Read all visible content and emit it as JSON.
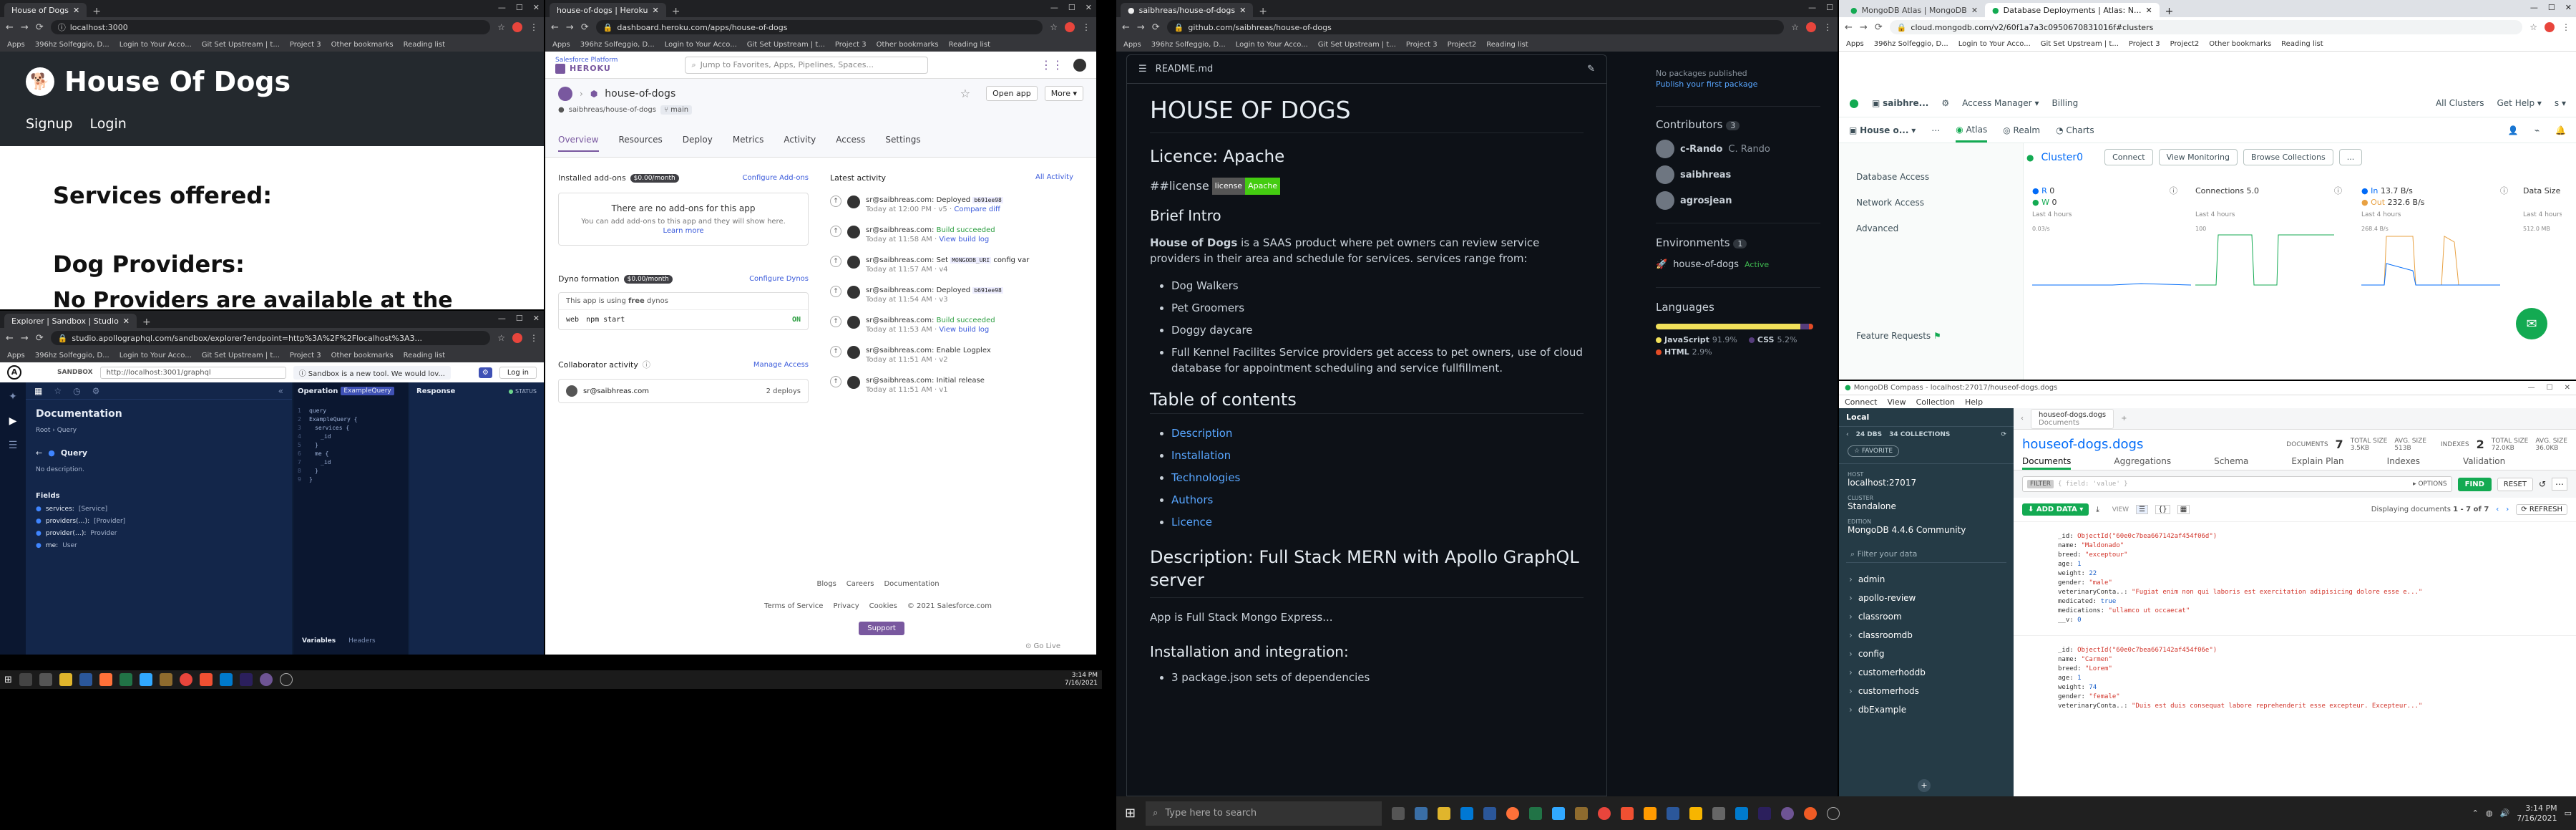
{
  "w1": {
    "tab": "House of Dogs",
    "url": "localhost:3000",
    "bookmarks": [
      "Apps",
      "396hz Solfeggio, D...",
      "Login to Your Acco...",
      "Git Set Upstream | t...",
      "Project 3",
      "Other bookmarks",
      "Reading list"
    ],
    "brand": "House Of Dogs",
    "nav": [
      "Signup",
      "Login"
    ],
    "services": "Services offered:",
    "providers": "Dog Providers:",
    "none": "No Providers are available at the moment!"
  },
  "w2": {
    "tab": "house-of-dogs | Heroku",
    "url": "dashboard.heroku.com/apps/house-of-dogs",
    "platform": "Salesforce Platform",
    "brand": "HEROKU",
    "search": "Jump to Favorites, Apps, Pipelines, Spaces...",
    "app": "house-of-dogs",
    "repo": "saibhreas/house-of-dogs",
    "branch": "main",
    "open": "Open app",
    "more": "More",
    "tabs": [
      "Overview",
      "Resources",
      "Deploy",
      "Metrics",
      "Activity",
      "Access",
      "Settings"
    ],
    "addons_title": "Installed add-ons",
    "addons_cost": "$0.00/month",
    "configure_addons": "Configure Add-ons",
    "no_addons": "There are no add-ons for this app",
    "no_addons_sub": "You can add add-ons to this app and they will show here.",
    "learn": "Learn more",
    "dyno_title": "Dyno formation",
    "dyno_cost": "$0.00/month",
    "configure_dynos": "Configure Dynos",
    "dyno_note": "This app is using",
    "dyno_free": "free",
    "dyno_note2": "dynos",
    "web": "web",
    "cmd": "npm start",
    "on": "ON",
    "collab_title": "Collaborator activity",
    "manage": "Manage Access",
    "collab_email": "sr@saibhreas.com",
    "collab_deploys": "2 deploys",
    "latest": "Latest activity",
    "all_activity": "All Activity",
    "activity": [
      {
        "who": "sr@saibhreas.com:",
        "what": "Deployed",
        "hash": "b691ee98",
        "when": "Today at 12:00 PM · v5",
        "link": "Compare diff"
      },
      {
        "who": "sr@saibhreas.com:",
        "what": "Build succeeded",
        "hash": "",
        "when": "Today at 11:58 AM",
        "link": "View build log"
      },
      {
        "who": "sr@saibhreas.com:",
        "what": "Set",
        "hash": "MONGODB_URI",
        "extra": "config var",
        "when": "Today at 11:57 AM · v4",
        "link": ""
      },
      {
        "who": "sr@saibhreas.com:",
        "what": "Deployed",
        "hash": "b691ee98",
        "when": "Today at 11:54 AM · v3",
        "link": ""
      },
      {
        "who": "sr@saibhreas.com:",
        "what": "Build succeeded",
        "hash": "",
        "when": "Today at 11:53 AM",
        "link": "View build log"
      },
      {
        "who": "sr@saibhreas.com:",
        "what": "Enable Logplex",
        "hash": "",
        "when": "Today at 11:51 AM · v2",
        "link": ""
      },
      {
        "who": "sr@saibhreas.com:",
        "what": "Initial release",
        "hash": "",
        "when": "Today at 11:51 AM · v1",
        "link": ""
      }
    ],
    "footer1": [
      "Blogs",
      "Careers",
      "Documentation"
    ],
    "footer2": [
      "Terms of Service",
      "Privacy",
      "Cookies",
      "© 2021 Salesforce.com"
    ],
    "support": "Support",
    "golive": "Go Live"
  },
  "w3": {
    "tab": "Explorer | Sandbox | Studio",
    "url": "studio.apollographql.com/sandbox/explorer?endpoint=http%3A%2F%2Flocalhost%3A3...",
    "sandbox": "SANDBOX",
    "endpoint": "http://localhost:3001/graphql",
    "notice": "Sandbox is a new tool. We would lov...",
    "login": "Log in",
    "doc_title": "Documentation",
    "root": "Root",
    "query_crumb": "Query",
    "query_label": "Query",
    "no_desc": "No description.",
    "fields": "Fields",
    "field_list": [
      {
        "name": "services:",
        "type": "[Service]"
      },
      {
        "name": "providers(…):",
        "type": "[Provider]"
      },
      {
        "name": "provider(…):",
        "type": "Provider"
      },
      {
        "name": "me:",
        "type": "User"
      }
    ],
    "ops": "Operation",
    "ops_tab": "ExampleQuery",
    "code": [
      "query",
      "ExampleQuery {",
      "services {",
      "_id",
      "}",
      "me {",
      "_id",
      "}",
      "}"
    ],
    "response": "Response",
    "status": "STATUS",
    "variables": "Variables",
    "headers": "Headers"
  },
  "taskbar_left": {
    "time": "3:14 PM",
    "date": "7/16/2021"
  },
  "w4": {
    "tab": "saibhreas/house-of-dogs",
    "url": "github.com/saibhreas/house-of-dogs",
    "bookmarks": [
      "Apps",
      "396hz Solfeggio, D...",
      "Login to Your Acco...",
      "Git Set Upstream | t...",
      "Project 3",
      "Project2",
      "Reading list"
    ],
    "file": "README.md",
    "h1": "HOUSE OF DOGS",
    "licence": "Licence: Apache",
    "license_md": "##license",
    "badge_a": "license",
    "badge_b": "Apache",
    "brief": "Brief Intro",
    "intro_b": "House of Dogs",
    "intro": " is a SAAS product where pet owners can review service providers in their area and schedule for services. services range from:",
    "services": [
      "Dog Walkers",
      "Pet Groomers",
      "Doggy daycare",
      "Full Kennel Facilites Service providers get access to pet owners, use of cloud database for appointment scheduling and service fullfillment."
    ],
    "toc": "Table of contents",
    "toc_items": [
      "Description",
      "Installation",
      "Technologies",
      "Authors",
      "Licence"
    ],
    "desc_h": "Description: Full Stack MERN with Apollo GraphQL server",
    "desc": "App is Full Stack Mongo Express...",
    "install_h": "Installation and integration:",
    "install_li": "3 package.json sets of dependencies",
    "side_pkg1": "No packages published",
    "side_pkg2": "Publish your first package",
    "contributors": "Contributors",
    "contrib_count": "3",
    "contribs": [
      {
        "login": "c-Rando",
        "name": "C. Rando"
      },
      {
        "login": "saibhreas",
        "name": ""
      },
      {
        "login": "agrosjean",
        "name": ""
      }
    ],
    "environments": "Environments",
    "env_count": "1",
    "env_name": "house-of-dogs",
    "env_status": "Active",
    "languages": "Languages",
    "langs": [
      {
        "name": "JavaScript",
        "pct": "91.9%",
        "frac": 0.919,
        "color": "#f1e05a"
      },
      {
        "name": "CSS",
        "pct": "5.2%",
        "frac": 0.052,
        "color": "#563d7c"
      },
      {
        "name": "HTML",
        "pct": "2.9%",
        "frac": 0.029,
        "color": "#e34c26"
      }
    ]
  },
  "w5": {
    "tabs": [
      "MongoDB Atlas | MongoDB",
      "Database Deployments | Atlas: N..."
    ],
    "url": "cloud.mongodb.com/v2/60f1a7a3c0950670831016f#clusters",
    "bookmarks": [
      "Apps",
      "396hz Solfeggio, D...",
      "Login to Your Acco...",
      "Git Set Upstream | t...",
      "Project 3",
      "Project2",
      "Other bookmarks",
      "Reading list"
    ],
    "org": "saibhre...",
    "access": "Access Manager",
    "billing": "Billing",
    "allclusters": "All Clusters",
    "help": "Get Help",
    "project": "House o...",
    "nav": [
      "Atlas",
      "Realm",
      "Charts"
    ],
    "side": [
      "Database Access",
      "Network Access",
      "Advanced"
    ],
    "feature": "Feature Requests",
    "cluster": "Cluster0",
    "cbuttons": [
      "Connect",
      "View Monitoring",
      "Browse Collections",
      "..."
    ],
    "r_label": "R",
    "r_val": "0",
    "w_label": "W",
    "w_val": "0",
    "last4": "Last 4 hours",
    "conn": "Connections",
    "conn_val": "5.0",
    "in_label": "In",
    "in_val": "13.7 B/s",
    "out_label": "Out",
    "out_val": "232.6 B/s",
    "datasize": "Data Size",
    "r_tick": "0.03/s",
    "c_tick": "100",
    "n_tick": "268.4 B/s",
    "d_tick": "512.0 MB"
  },
  "w6": {
    "title": "MongoDB Compass - localhost:27017/houseof-dogs.dogs",
    "menu": [
      "Connect",
      "View",
      "Collection",
      "Help"
    ],
    "local": "Local",
    "dbs": "24 DBS",
    "colls": "34 COLLECTIONS",
    "fav": "FAVORITE",
    "host_l": "HOST",
    "host": "localhost:27017",
    "cluster_l": "CLUSTER",
    "cluster": "Standalone",
    "edition_l": "EDITION",
    "edition": "MongoDB 4.4.6 Community",
    "filter_ph": "Filter your data",
    "dblist": [
      "admin",
      "apollo-review",
      "classroom",
      "classroomdb",
      "config",
      "customerhoddb",
      "customerhods",
      "dbExample"
    ],
    "crumb_db": "houseof-dogs.dogs",
    "crumb_sub": "Documents",
    "ns": "houseof-dogs.dogs",
    "docs_l": "DOCUMENTS",
    "docs": "7",
    "tsize_l": "TOTAL SIZE",
    "tsize": "3.5KB",
    "avg_l": "AVG. SIZE",
    "avg": "513B",
    "idx_l": "INDEXES",
    "idx": "2",
    "itsize": "72.0KB",
    "iavg": "36.0KB",
    "tabs": [
      "Documents",
      "Aggregations",
      "Schema",
      "Explain Plan",
      "Indexes",
      "Validation"
    ],
    "filter_tag": "FILTER",
    "filter_val": "{ field: 'value' }",
    "options": "OPTIONS",
    "find": "FIND",
    "reset": "RESET",
    "add": "ADD DATA",
    "view": "VIEW",
    "displaying": "Displaying documents",
    "range": "1 - 7 of 7",
    "refresh": "REFRESH",
    "doc1": [
      [
        "_id:",
        "ObjectId(\"60e0c7bea667142af454f06d\")"
      ],
      [
        "name:",
        "\"Maldonado\""
      ],
      [
        "breed:",
        "\"exceptour\""
      ],
      [
        "age:",
        "1"
      ],
      [
        "weight:",
        "22"
      ],
      [
        "gender:",
        "\"male\""
      ],
      [
        "veterinaryConta..:",
        "\"Fugiat enim non qui laboris est exercitation adipisicing dolore esse e...\""
      ],
      [
        "medicated:",
        "true"
      ],
      [
        "medications:",
        "\"ullamco ut occaecat\""
      ],
      [
        "__v:",
        "0"
      ]
    ],
    "doc2": [
      [
        "_id:",
        "ObjectId(\"60e0c7bea667142af454f06e\")"
      ],
      [
        "name:",
        "\"Carmen\""
      ],
      [
        "breed:",
        "\"Lorem\""
      ],
      [
        "age:",
        "1"
      ],
      [
        "weight:",
        "74"
      ],
      [
        "gender:",
        "\"female\""
      ],
      [
        "veterinaryConta..:",
        "\"Duis est duis consequat labore reprehenderit esse excepteur. Excepteur...\""
      ]
    ]
  },
  "taskbar_right": {
    "search": "Type here to search",
    "time": "3:14 PM",
    "date": "7/16/2021"
  }
}
